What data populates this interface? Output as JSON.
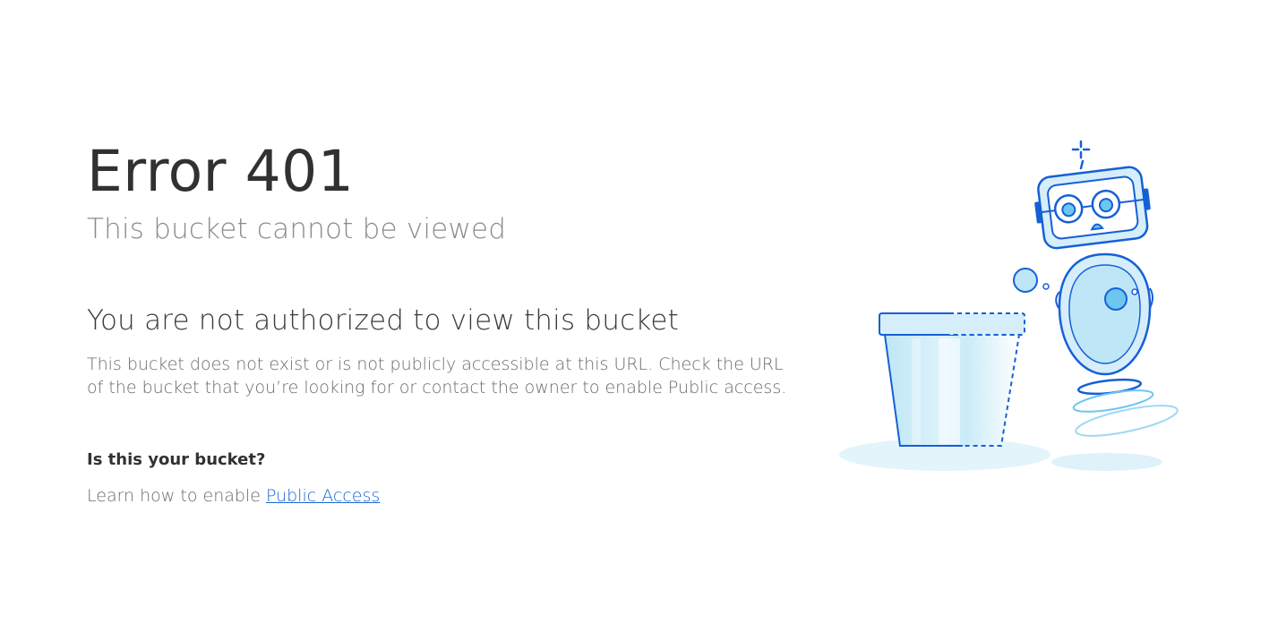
{
  "error": {
    "code": "Error 401",
    "subtitle": "This bucket cannot be viewed"
  },
  "message": {
    "headline": "You are not authorized to view this bucket",
    "description_line1": "This bucket does not exist or is not publicly accessible at this URL. Check the URL",
    "description_line2": "of the bucket that you’re looking for or contact the owner to enable Public access."
  },
  "help": {
    "question": "Is this your bucket?",
    "learn_prefix": "Learn how to enable ",
    "link_label": "Public Access"
  },
  "colors": {
    "link": "#1a66d2",
    "illustration_stroke": "#1660d6",
    "illustration_fill": "#bfe6f7"
  },
  "icons": {
    "illustration": "robot-and-bucket-illustration"
  }
}
